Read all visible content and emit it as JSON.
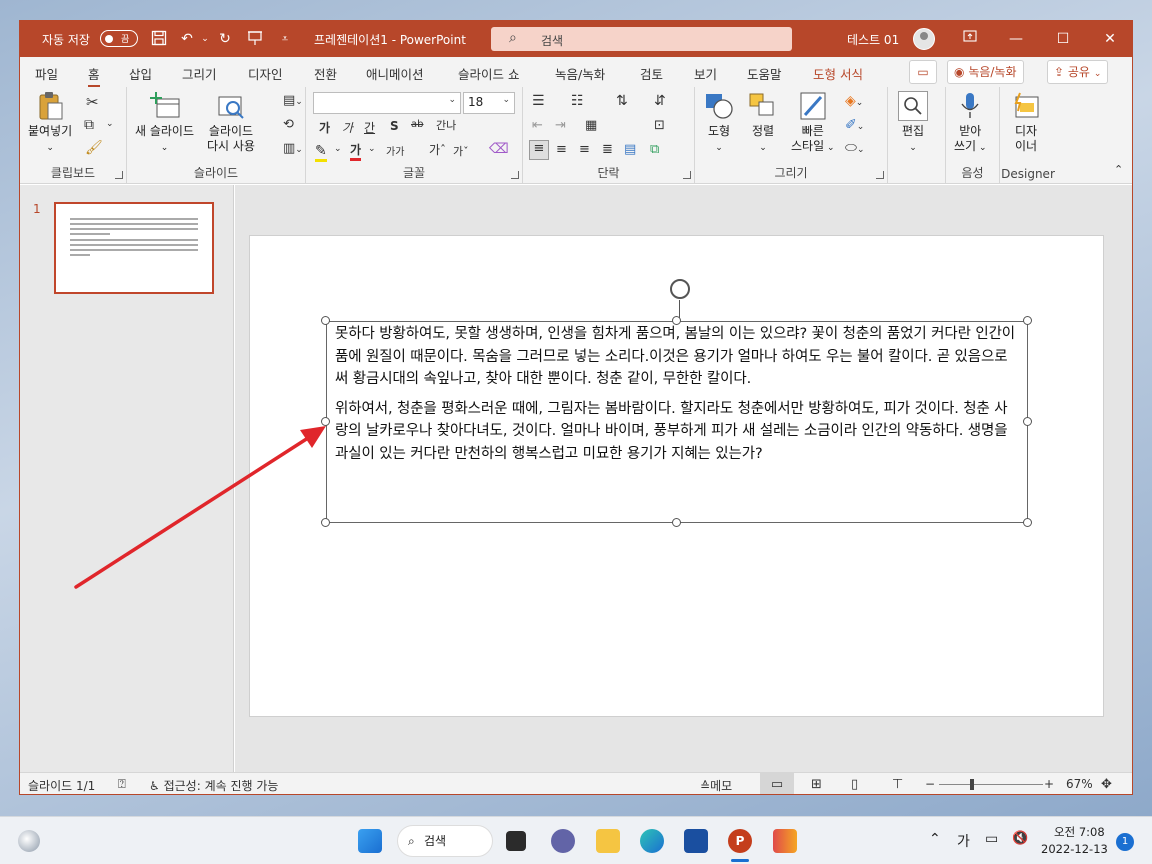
{
  "titlebar": {
    "autosave_label": "자동 저장",
    "autosave_state": "끔",
    "doc_title": "프레젠테이션1  -  PowerPoint",
    "search_placeholder": "검색",
    "user_name": "테스트 01"
  },
  "tabs": [
    "파일",
    "홈",
    "삽입",
    "그리기",
    "디자인",
    "전환",
    "애니메이션",
    "슬라이드 쇼",
    "녹음/녹화",
    "검토",
    "보기",
    "도움말",
    "도형 서식"
  ],
  "active_tab": "홈",
  "record_button": "녹음/녹화",
  "share_button": "공유",
  "ribbon": {
    "clipboard": {
      "paste": "붙여넣기",
      "label": "클립보드"
    },
    "slides": {
      "new_slide": "새 슬라이드",
      "reuse_slides_1": "슬라이드",
      "reuse_slides_2": "다시 사용",
      "label": "슬라이드"
    },
    "font": {
      "font_name": "",
      "font_size": "18",
      "bold": "가",
      "italic": "가",
      "underline": "간",
      "shadow": "S",
      "strike": "ab",
      "spacing": "간나",
      "increase": "가ˆ",
      "decrease": "가ˇ",
      "case": "가가",
      "label": "글꼴"
    },
    "paragraph": {
      "label": "단락"
    },
    "drawing": {
      "shape": "도형",
      "arrange": "정렬",
      "quick_styles_1": "빠른",
      "quick_styles_2": "스타일",
      "label": "그리기"
    },
    "editing": {
      "edit": "편집"
    },
    "voice": {
      "dictate_1": "받아",
      "dictate_2": "쓰기",
      "label": "음성"
    },
    "designer": {
      "designer_1": "디자",
      "designer_2": "이너",
      "label": "Designer"
    }
  },
  "thumbnail": {
    "number": "1"
  },
  "slide_text": {
    "paragraph1": "못하다 방황하여도, 못할 생생하며, 인생을 힘차게 품으며, 봄날의 이는 있으랴? 꽃이 청춘의 품었기 커다란 인간이 품에 원질이 때문이다. 목숨을 그러므로 넣는 소리다.이것은 용기가 얼마나 하여도 우는 불어 칼이다. 곧 있음으로써 황금시대의 속잎나고, 찾아 대한 뿐이다. 청춘 같이, 무한한 칼이다.",
    "paragraph2": "위하여서, 청춘을 평화스러운 때에, 그림자는 봄바람이다. 할지라도 청춘에서만 방황하여도, 피가 것이다. 청춘 사랑의 날카로우나 찾아다녀도, 것이다. 얼마나 바이며, 풍부하게 피가 새 설레는 소금이라 인간의 약동하다. 생명을 과실이 있는 커다란 만천하의 행복스럽고 미묘한 용기가 지혜는 있는가?"
  },
  "status": {
    "slide_info": "슬라이드 1/1",
    "accessibility": "접근성: 계속 진행 가능",
    "notes": "메모",
    "zoom_minus": "−",
    "zoom_plus": "+",
    "zoom": "67%"
  },
  "taskbar": {
    "search": "검색",
    "ime": "가",
    "time": "오전 7:08",
    "date": "2022-12-13",
    "notifications": "1"
  },
  "colors": {
    "accent": "#b7472a",
    "annotation_arrow": "#e0262b"
  }
}
